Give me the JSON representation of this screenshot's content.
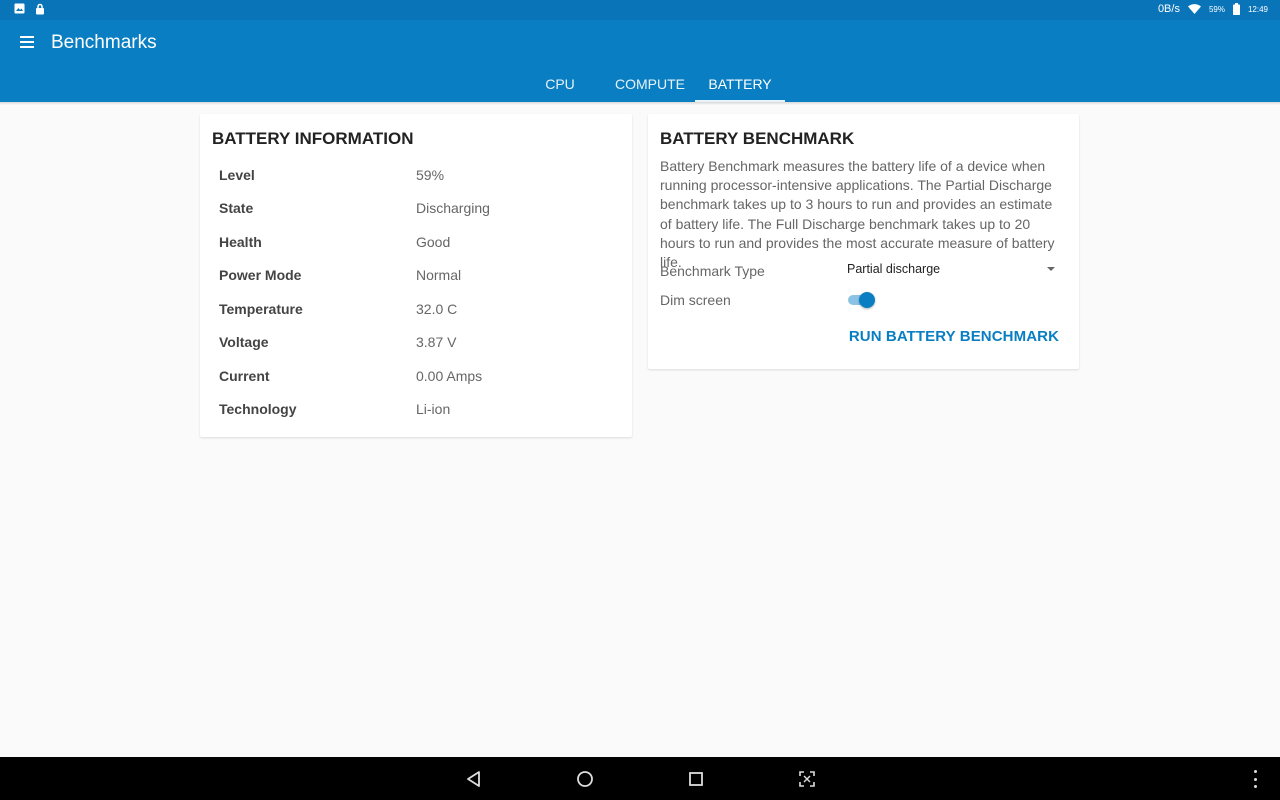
{
  "status_bar": {
    "net_speed": "0B/s",
    "battery_percent": "59%",
    "time": "12:49"
  },
  "app": {
    "title": "Benchmarks",
    "tabs": [
      {
        "label": "CPU",
        "active": false
      },
      {
        "label": "COMPUTE",
        "active": false
      },
      {
        "label": "BATTERY",
        "active": true
      }
    ]
  },
  "battery_info": {
    "title": "BATTERY INFORMATION",
    "rows": [
      {
        "label": "Level",
        "value": "59%"
      },
      {
        "label": "State",
        "value": "Discharging"
      },
      {
        "label": "Health",
        "value": "Good"
      },
      {
        "label": "Power Mode",
        "value": "Normal"
      },
      {
        "label": "Temperature",
        "value": "32.0 C"
      },
      {
        "label": "Voltage",
        "value": "3.87 V"
      },
      {
        "label": "Current",
        "value": "0.00 Amps"
      },
      {
        "label": "Technology",
        "value": "Li-ion"
      }
    ]
  },
  "battery_benchmark": {
    "title": "BATTERY BENCHMARK",
    "description": "Battery Benchmark measures the battery life of a device when running processor-intensive applications. The Partial Discharge benchmark takes up to 3 hours to run and provides an estimate of battery life. The Full Discharge benchmark takes up to 20 hours to run and provides the most accurate measure of battery life.",
    "benchmark_type_label": "Benchmark Type",
    "benchmark_type_value": "Partial discharge",
    "dim_screen_label": "Dim screen",
    "dim_screen_on": true,
    "run_button": "RUN BATTERY BENCHMARK"
  },
  "colors": {
    "primary": "#0a7ec2",
    "status_bar": "#0a74b8",
    "background": "#fafafa"
  }
}
